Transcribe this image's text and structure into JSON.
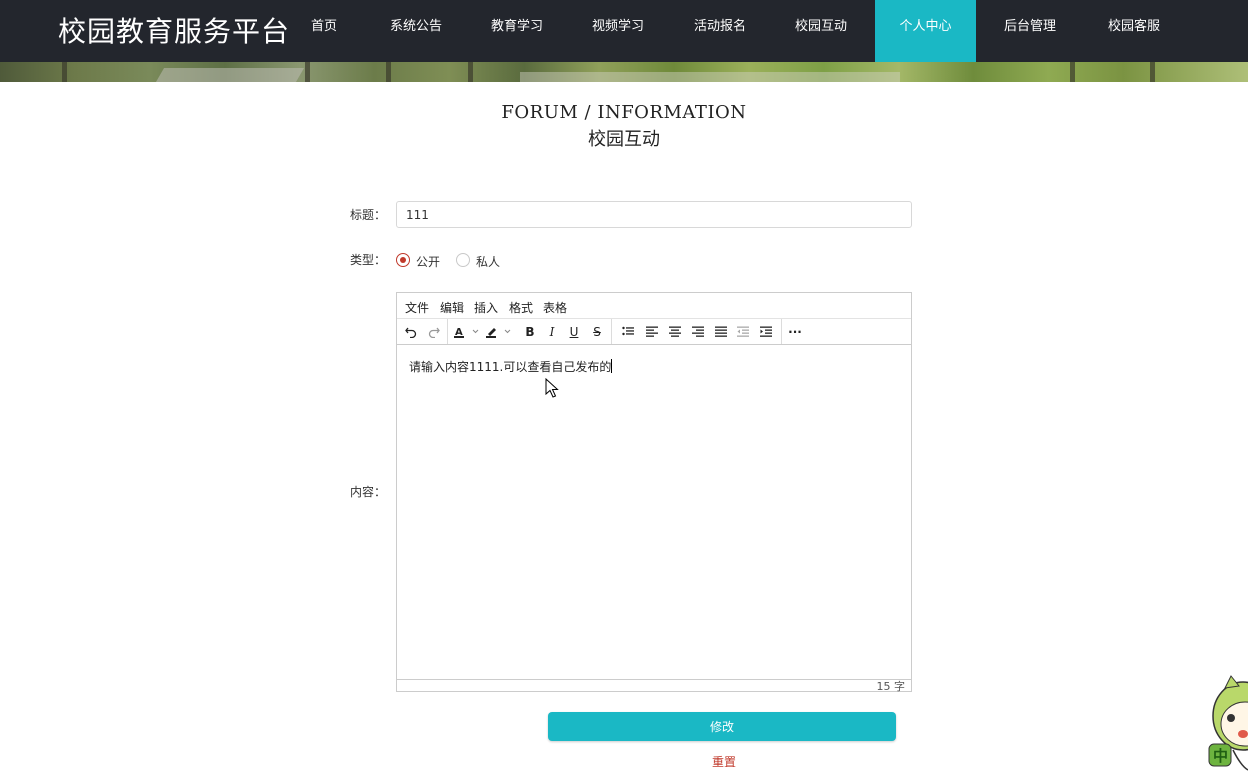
{
  "header": {
    "brand": "校园教育服务平台",
    "nav": [
      {
        "label": "首页",
        "active": false
      },
      {
        "label": "系统公告",
        "active": false
      },
      {
        "label": "教育学习",
        "active": false
      },
      {
        "label": "视频学习",
        "active": false
      },
      {
        "label": "活动报名",
        "active": false
      },
      {
        "label": "校园互动",
        "active": false
      },
      {
        "label": "个人中心",
        "active": true
      },
      {
        "label": "后台管理",
        "active": false
      },
      {
        "label": "校园客服",
        "active": false
      }
    ]
  },
  "section": {
    "title_en": "FORUM / INFORMATION",
    "title_zh": "校园互动"
  },
  "form": {
    "title_label": "标题：",
    "title_value": "111",
    "type_label": "类型：",
    "type_options": [
      {
        "label": "公开",
        "checked": true
      },
      {
        "label": "私人",
        "checked": false
      }
    ],
    "content_label": "内容：",
    "editor": {
      "menus": [
        "文件",
        "编辑",
        "插入",
        "格式",
        "表格"
      ],
      "toolbar": [
        "undo-icon",
        "redo-icon",
        "font-color-icon",
        "highlight-icon",
        "bold-icon",
        "italic-icon",
        "underline-icon",
        "strikethrough-icon",
        "bullet-list-icon",
        "align-left-icon",
        "align-center-icon",
        "align-right-icon",
        "align-justify-icon",
        "outdent-icon",
        "indent-icon",
        "more-icon"
      ],
      "content": "请输入内容1111.可以查看自己发布的",
      "word_count": "15 字"
    },
    "submit_label": "修改",
    "reset_label": "重置"
  },
  "colors": {
    "accent": "#1ab8c5",
    "header_bg": "#23262d",
    "danger": "#c0392b"
  }
}
